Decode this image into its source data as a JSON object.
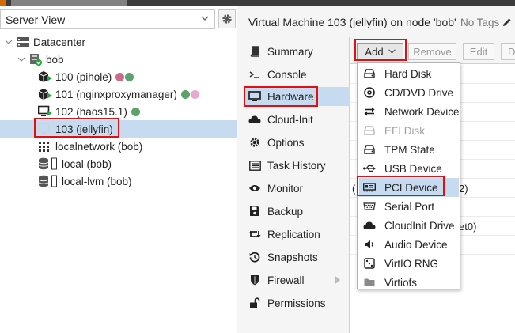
{
  "view_selector": {
    "value": "Server View"
  },
  "tree": {
    "datacenter": "Datacenter",
    "node": "bob",
    "vms": [
      {
        "label": "100 (pihole)",
        "status_colors": [
          "#c96d8a",
          "#5aa469"
        ]
      },
      {
        "label": "101 (nginxproxymanager)",
        "status_colors": [
          "#5aa469",
          "#e8a8d0"
        ]
      },
      {
        "label": "102 (haos15.1)",
        "status_colors": [
          "#5aa469"
        ]
      },
      {
        "label": "103 (jellyfin)",
        "status_colors": []
      }
    ],
    "network": "localnetwork (bob)",
    "storages": [
      "local (bob)",
      "local-lvm (bob)"
    ]
  },
  "header": {
    "title": "Virtual Machine 103 (jellyfin) on node 'bob'",
    "tags": "No Tags"
  },
  "subnav": [
    {
      "label": "Summary",
      "icon": "book-icon"
    },
    {
      "label": "Console",
      "icon": "terminal-icon"
    },
    {
      "label": "Hardware",
      "icon": "desktop-icon",
      "selected": true
    },
    {
      "label": "Cloud-Init",
      "icon": "cloud-icon"
    },
    {
      "label": "Options",
      "icon": "gear-icon"
    },
    {
      "label": "Task History",
      "icon": "list-icon"
    },
    {
      "label": "Monitor",
      "icon": "eye-icon"
    },
    {
      "label": "Backup",
      "icon": "floppy-icon"
    },
    {
      "label": "Replication",
      "icon": "retweet-icon"
    },
    {
      "label": "Snapshots",
      "icon": "history-icon"
    },
    {
      "label": "Firewall",
      "icon": "shield-icon",
      "has_arrow": true
    },
    {
      "label": "Permissions",
      "icon": "unlock-icon"
    }
  ],
  "toolbar": {
    "add": "Add",
    "remove": "Remove",
    "edit": "Edit",
    "more": "D"
  },
  "content_rows": [
    {
      "text": "("
    },
    {
      "text": "2)"
    },
    {
      "text": "et0)"
    }
  ],
  "add_menu": [
    {
      "label": "Hard Disk",
      "icon": "hdd-icon"
    },
    {
      "label": "CD/DVD Drive",
      "icon": "cdrom-icon"
    },
    {
      "label": "Network Device",
      "icon": "exchange-icon"
    },
    {
      "label": "EFI Disk",
      "icon": "efi-disk-icon",
      "disabled": true
    },
    {
      "label": "TPM State",
      "icon": "tpm-hdd-icon"
    },
    {
      "label": "USB Device",
      "icon": "usb-icon"
    },
    {
      "label": "PCI Device",
      "icon": "pci-card-icon",
      "highlighted": true
    },
    {
      "label": "Serial Port",
      "icon": "serial-port-icon"
    },
    {
      "label": "CloudInit Drive",
      "icon": "cloud-icon"
    },
    {
      "label": "Audio Device",
      "icon": "volume-icon"
    },
    {
      "label": "VirtIO RNG",
      "icon": "dice-icon"
    },
    {
      "label": "Virtiofs",
      "icon": "folder-icon"
    }
  ],
  "colors": {
    "selection": "#c6dbf0",
    "callout": "#e01010",
    "running": "#25a73e"
  }
}
